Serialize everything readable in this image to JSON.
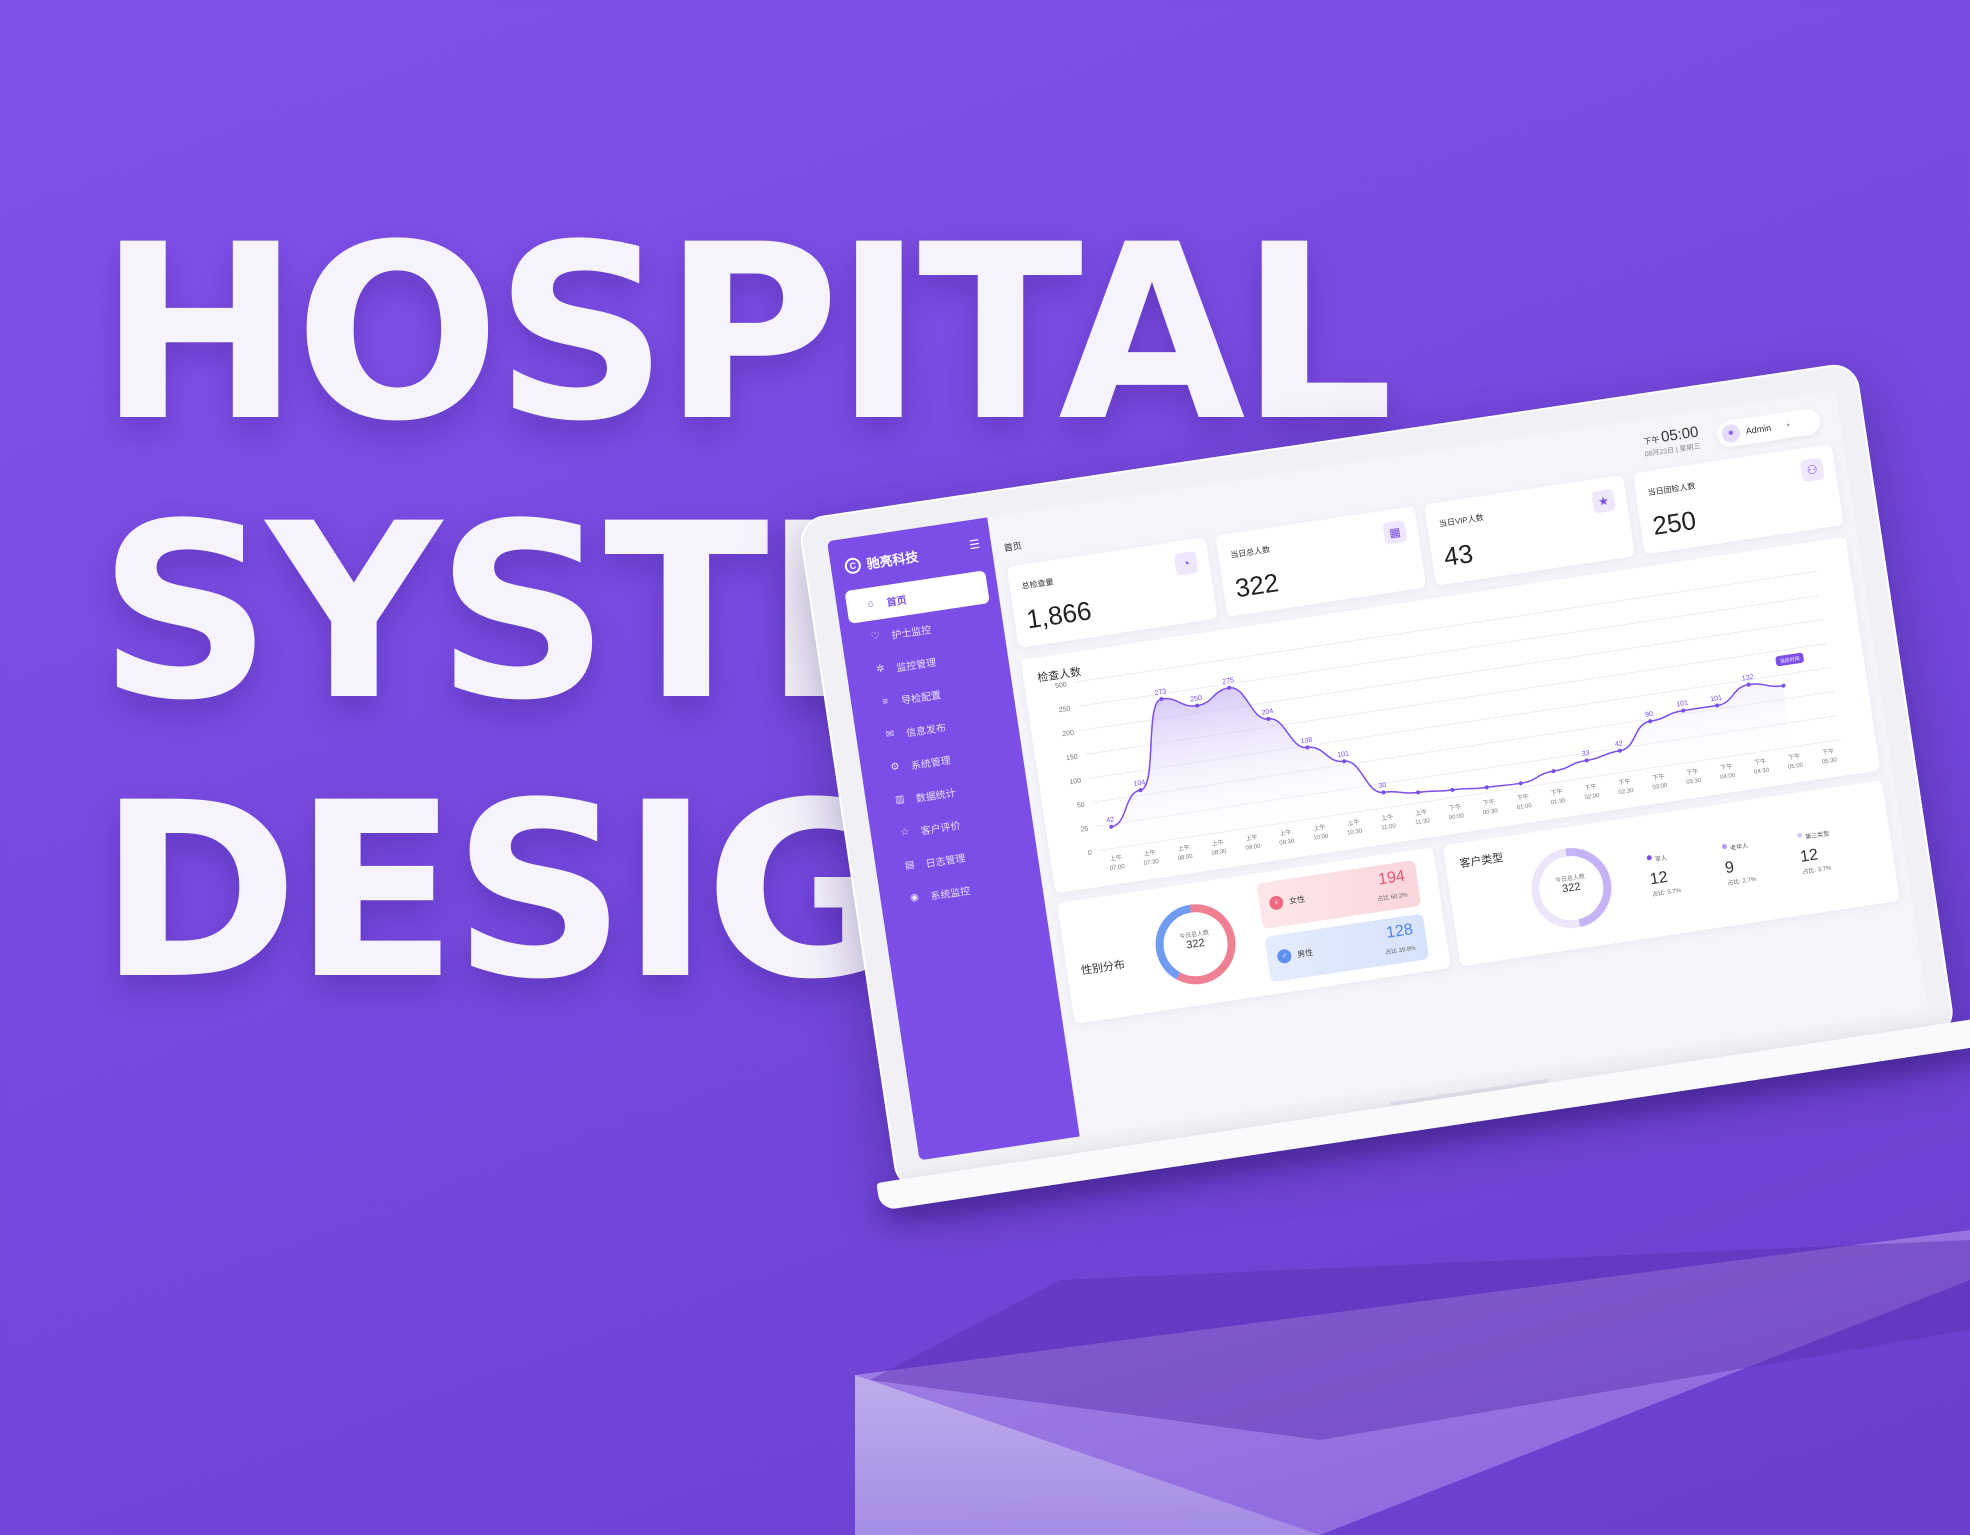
{
  "hero": {
    "line1": "HOSPITAL",
    "line2": "SYSTEM",
    "line3": "DESIG"
  },
  "colors": {
    "background": "#7a4de6",
    "sidebar": "#7b4ee8",
    "accent": "#7b4ee8",
    "female": "#e8566f",
    "male": "#4f82e6"
  },
  "sidebar": {
    "brand": "驰亮科技",
    "brand_icon": "logo-icon",
    "items": [
      {
        "label": "首页",
        "icon": "home-icon",
        "active": true
      },
      {
        "label": "护士监控",
        "icon": "heart-pulse-icon"
      },
      {
        "label": "监控管理",
        "icon": "settings-icon"
      },
      {
        "label": "导检配置",
        "icon": "sliders-icon"
      },
      {
        "label": "信息发布",
        "icon": "mail-icon"
      },
      {
        "label": "系统管理",
        "icon": "gear-icon"
      },
      {
        "label": "数据统计",
        "icon": "bar-chart-icon"
      },
      {
        "label": "客户评价",
        "icon": "star-message-icon"
      },
      {
        "label": "日志管理",
        "icon": "document-icon"
      },
      {
        "label": "系统监控",
        "icon": "monitor-icon"
      }
    ]
  },
  "header": {
    "breadcrumb": "首页",
    "ampm": "下午",
    "time": "05:00",
    "date": "08月23日 | 星期三",
    "user": "Admin"
  },
  "cards": [
    {
      "label": "总检查量",
      "value": "1,866",
      "icon": "pie-chart-icon"
    },
    {
      "label": "当日总人数",
      "value": "322",
      "icon": "calendar-icon"
    },
    {
      "label": "当日VIP人数",
      "value": "43",
      "icon": "star-icon"
    },
    {
      "label": "当日团检人数",
      "value": "250",
      "icon": "group-icon"
    }
  ],
  "chart_title": "检查人数",
  "chart_data": {
    "type": "area",
    "title": "检查人数",
    "xlabel": "",
    "ylabel": "",
    "ylim": [
      0,
      500
    ],
    "yticks": [
      "500",
      "250",
      "200",
      "150",
      "100",
      "50",
      "25",
      "0"
    ],
    "x": [
      "上午 07:00",
      "上午 07:30",
      "上午 08:00",
      "上午 08:30",
      "上午 09:00",
      "上午 09:30",
      "上午 10:00",
      "上午 10:30",
      "上午 11:00",
      "上午 11:30",
      "下午 00:00",
      "下午 00:30",
      "下午 01:00",
      "下午 01:30",
      "下午 02:00",
      "下午 02:30",
      "下午 03:00",
      "下午 03:30",
      "下午 04:00",
      "下午 04:30",
      "下午 05:00",
      "下午 05:30"
    ],
    "values": [
      42,
      104,
      273,
      250,
      275,
      204,
      138,
      101,
      30,
      20,
      15,
      10,
      8,
      22,
      33,
      42,
      90,
      101,
      101,
      132,
      120,
      null
    ],
    "labeled_values": [
      "42",
      "104",
      "273",
      "250",
      "275",
      "204",
      "138",
      "101",
      "30",
      "33",
      "42",
      "90",
      "101",
      "101",
      "132"
    ],
    "current_marker": "当前时间",
    "grid": true
  },
  "gender": {
    "title": "性别分布",
    "center_label": "今日总人数",
    "center_value": "322",
    "female": {
      "label": "女性",
      "value": "194",
      "percent": "占比 60.2%",
      "fraction": 0.602
    },
    "male": {
      "label": "男性",
      "value": "128",
      "percent": "占比 39.8%",
      "fraction": 0.398
    }
  },
  "customers": {
    "title": "客户类型",
    "center_label": "今日总人数",
    "center_value": "322",
    "types": [
      {
        "label": "军人",
        "value": "12",
        "percent": "占比: 3.7%",
        "color": "#7b4ee8"
      },
      {
        "label": "老年人",
        "value": "9",
        "percent": "占比: 2.7%",
        "color": "#b79af3"
      },
      {
        "label": "第三类型",
        "value": "12",
        "percent": "占比: 3.7%",
        "color": "#d9cbf9"
      }
    ]
  }
}
